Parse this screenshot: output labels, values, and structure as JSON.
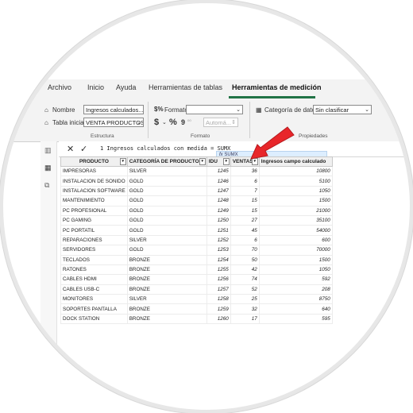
{
  "ribbon_tabs": {
    "archivo": "Archivo",
    "inicio": "Inicio",
    "ayuda": "Ayuda",
    "herr_tablas": "Herramientas de tablas",
    "herr_medicion": "Herramientas de medición"
  },
  "estructura": {
    "nombre_label": "Nombre",
    "nombre_value": "Ingresos calculados...",
    "tabla_label": "Tabla inicial",
    "tabla_value": "VENTA PRODUCTOS",
    "group_label": "Estructura"
  },
  "formato": {
    "formato_label": "Formato",
    "formato_value": "",
    "currency_symbol": "$",
    "percent_symbol": "%",
    "comma_symbol": "9",
    "decimals_value": "Automá...",
    "group_label": "Formato"
  },
  "propiedades": {
    "categoria_label": "Categoría de datos",
    "categoria_value": "Sin clasificar",
    "group_label": "Propiedades"
  },
  "formula_bar": {
    "cancel_symbol": "✕",
    "confirm_symbol": "✓",
    "formula": "1 Ingresos calculados con medida = SUMX",
    "tooltip": "SUMX",
    "tooltip_fx": "fx"
  },
  "table": {
    "columns": [
      "PRODUCTO",
      "CATEGORÍA DE PRODUCTOS",
      "IDU",
      "VENTAS",
      "Ingresos campo calculado"
    ],
    "rows": [
      [
        "IMPRESORAS",
        "SILVER",
        "1245",
        "36",
        "10800"
      ],
      [
        "INSTALACION DE SONIDO",
        "GOLD",
        "1246",
        "6",
        "5100"
      ],
      [
        "INSTALACION SOFTWARE",
        "GOLD",
        "1247",
        "7",
        "1050"
      ],
      [
        "MANTENIMIENTO",
        "GOLD",
        "1248",
        "15",
        "1500"
      ],
      [
        "PC PROFESIONAL",
        "GOLD",
        "1249",
        "15",
        "21000"
      ],
      [
        "PC GAMING",
        "GOLD",
        "1250",
        "27",
        "35100"
      ],
      [
        "PC PORTATIL",
        "GOLD",
        "1251",
        "45",
        "54000"
      ],
      [
        "REPARACIONES",
        "SILVER",
        "1252",
        "6",
        "600"
      ],
      [
        "SERVIDORES",
        "GOLD",
        "1253",
        "70",
        "70000"
      ],
      [
        "TECLADOS",
        "BRONZE",
        "1254",
        "50",
        "1500"
      ],
      [
        "RATONES",
        "BRONZE",
        "1255",
        "42",
        "1050"
      ],
      [
        "CABLES HDMI",
        "BRONZE",
        "1256",
        "74",
        "592"
      ],
      [
        "CABLES USB-C",
        "BRONZE",
        "1257",
        "52",
        "208"
      ],
      [
        "MONITORES",
        "SILVER",
        "1258",
        "25",
        "8750"
      ],
      [
        "SOPORTES PANTALLA",
        "BRONZE",
        "1259",
        "32",
        "640"
      ],
      [
        "DOCK STATION",
        "BRONZE",
        "1260",
        "17",
        "595"
      ]
    ]
  },
  "annotation": {
    "arrow_color": "#e8262a"
  },
  "colors": {
    "accent": "#217346"
  }
}
